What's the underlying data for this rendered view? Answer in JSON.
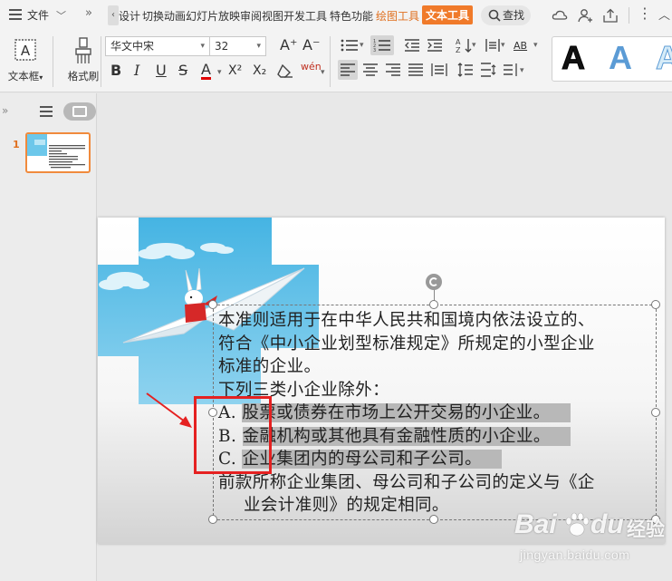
{
  "menubar": {
    "file_label": "文件",
    "tabs": [
      "设计",
      "切换",
      "动画",
      "幻灯片放映",
      "审阅",
      "视图",
      "开发工具",
      "特色功能",
      "绘图工具",
      "文本工具"
    ],
    "search_label": "查找"
  },
  "ribbon": {
    "textbox_label": "文本框",
    "format_painter_label": "格式刷",
    "font_name": "华文中宋",
    "font_size": "32",
    "bold": "B",
    "italic": "I",
    "underline": "U",
    "strike": "S",
    "font_color": "A",
    "superscript": "X²",
    "subscript": "X₂",
    "phonetic": "wén",
    "grow_font": "A⁺",
    "shrink_font": "A⁻",
    "text_direction": "AB",
    "styles": [
      "A",
      "A",
      "A"
    ]
  },
  "left_pane": {
    "slide_number": "1"
  },
  "slide": {
    "lines": [
      "本准则适用于在中华人民共和国境内依法设立的、",
      "符合《中小企业划型标准规定》所规定的小型企业",
      "标准的企业。",
      "下列三类小企业除外：",
      {
        "prefix": "A. ",
        "text": "股票或债券在市场上公开交易的小企业。"
      },
      {
        "prefix": "B. ",
        "text": "金融机构或其他具有金融性质的小企业。"
      },
      {
        "prefix": "C. ",
        "text": "企业集团内的母公司和子公司。"
      },
      "前款所称企业集团、母公司和子公司的定义与《企",
      "业会计准则》的规定相同。"
    ]
  },
  "watermark": {
    "brand": "Bai",
    "brand2": "du",
    "suffix": "经验",
    "url": "jingyan.baidu.com"
  },
  "colors": {
    "accent_orange": "#f07a2a",
    "annotation_red": "#e52121",
    "highlight_gray": "#b8b8b8"
  }
}
